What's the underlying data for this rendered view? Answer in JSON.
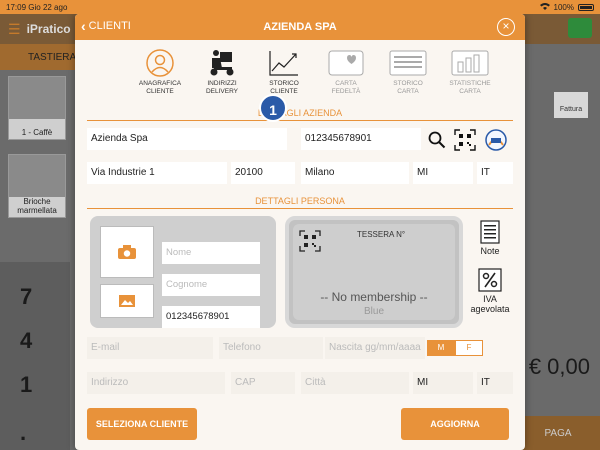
{
  "status_bar": {
    "time": "17:09",
    "date": "Gio 22 ago",
    "battery": "100%"
  },
  "background": {
    "brand": "iPratico",
    "tab_label": "TASTIERA",
    "tile1_label": "1 - Caffè",
    "tile2_label": "Brioche marmellata",
    "keys": [
      "7",
      "4",
      "1",
      "."
    ],
    "amount": "€ 0,00",
    "pay_label": "PAGA",
    "invoice_label": "Fattura"
  },
  "modal": {
    "back_label": "CLIENTI",
    "title": "AZIENDA SPA",
    "tabs": [
      {
        "label": "ANAGRAFICA CLIENTE",
        "icon": "user-circle-icon",
        "enabled": true
      },
      {
        "label": "INDIRIZZI DELIVERY",
        "icon": "delivery-scooter-icon",
        "enabled": true
      },
      {
        "label": "STORICO CLIENTE",
        "icon": "trend-chart-icon",
        "enabled": true
      },
      {
        "label": "CARTA FEDELTÀ",
        "icon": "heart-card-icon",
        "enabled": false
      },
      {
        "label": "STORICO CARTA",
        "icon": "card-list-icon",
        "enabled": false
      },
      {
        "label": "STATISTICHE CARTA",
        "icon": "bar-chart-icon",
        "enabled": false
      }
    ],
    "badge": "1",
    "azienda_section": "DETTAGLI AZIENDA",
    "company_name": "Azienda Spa",
    "vat_number": "012345678901",
    "address": "Via Industrie 1",
    "zip": "20100",
    "city": "Milano",
    "province": "MI",
    "country": "IT",
    "persona_section": "DETTAGLI PERSONA",
    "name_placeholder": "Nome",
    "surname_placeholder": "Cognome",
    "person_vat": "012345678901",
    "tessera_label": "TESSERA N°",
    "no_membership": "-- No membership --",
    "card_color": "Blue",
    "note_label": "Note",
    "iva_label": "IVA agevolata",
    "email_placeholder": "E-mail",
    "phone_placeholder": "Telefono",
    "birth_placeholder": "Nascita gg/mm/aaaa",
    "gender_m": "M",
    "gender_f": "F",
    "addr_placeholder": "Indirizzo",
    "cap_placeholder": "CAP",
    "city_placeholder": "Città",
    "province2": "MI",
    "country2": "IT",
    "select_button": "SELEZIONA CLIENTE",
    "update_button": "AGGIORNA"
  },
  "colors": {
    "accent": "#e8923a",
    "badge": "#2a5aa8"
  }
}
